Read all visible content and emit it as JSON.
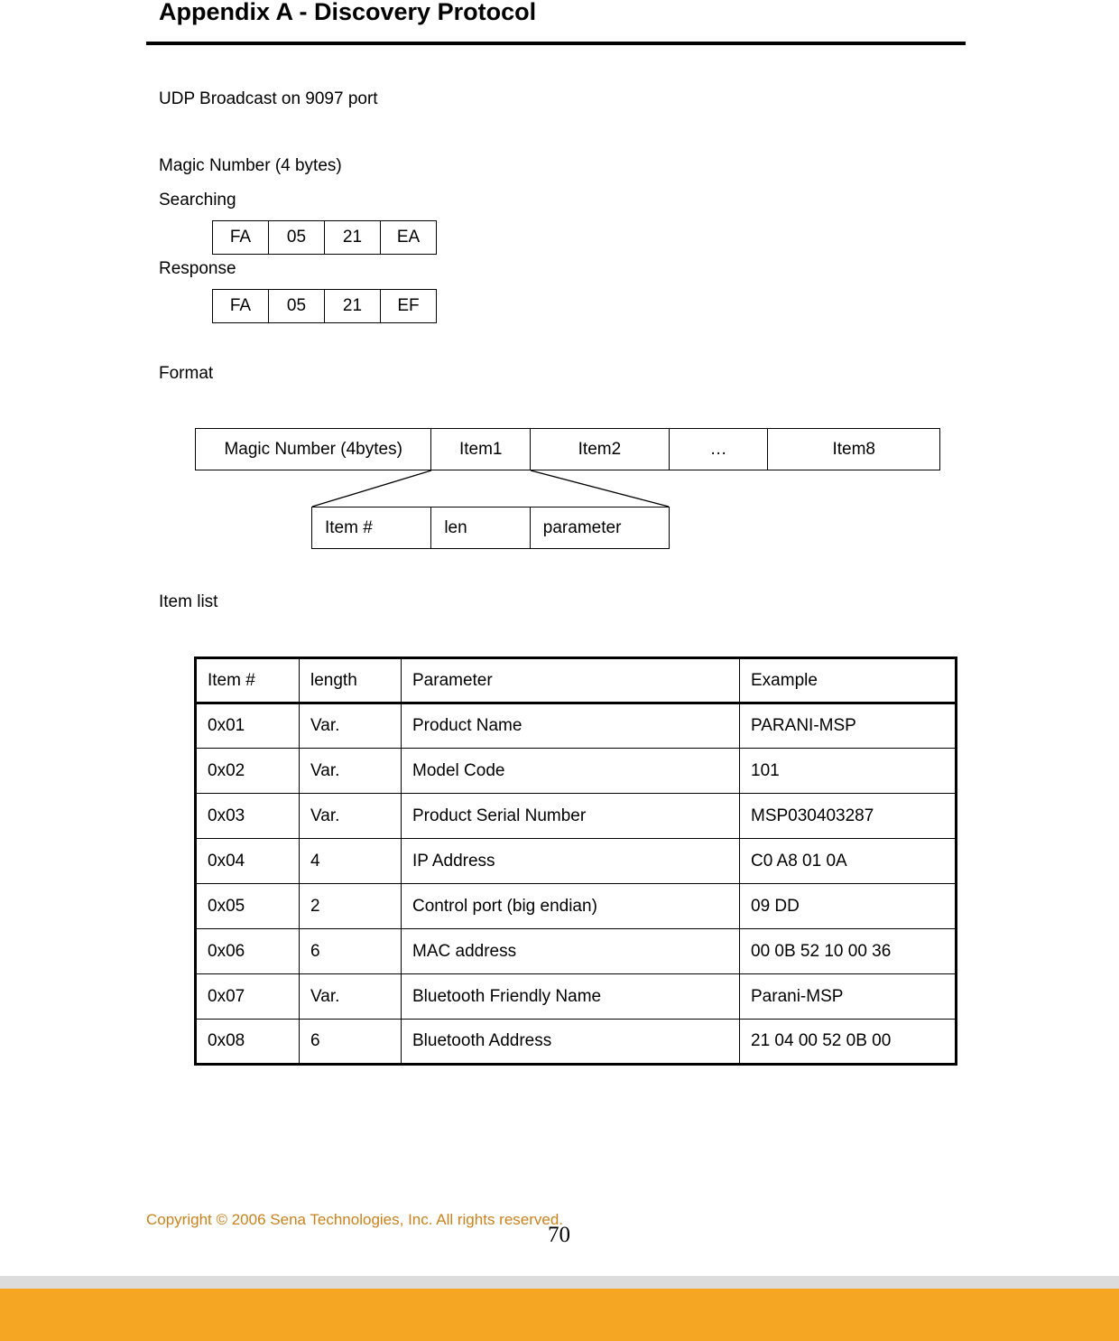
{
  "header": {
    "title": "Appendix A - Discovery Protocol"
  },
  "intro": {
    "udp_line": "UDP Broadcast on 9097 port"
  },
  "magic_number": {
    "heading": "Magic Number (4 bytes)",
    "searching_label": "Searching",
    "searching_bytes": [
      "FA",
      "05",
      "21",
      "EA"
    ],
    "response_label": "Response",
    "response_bytes": [
      "FA",
      "05",
      "21",
      "EF"
    ]
  },
  "format": {
    "heading": "Format",
    "packet_cells": [
      "Magic Number (4bytes)",
      "Item1",
      "Item2",
      "…",
      "Item8"
    ],
    "item_cells": [
      "Item #",
      "len",
      "parameter"
    ]
  },
  "item_list": {
    "heading": "Item list",
    "columns": [
      "Item #",
      "length",
      "Parameter",
      "Example"
    ],
    "rows": [
      [
        "0x01",
        "Var.",
        "Product Name",
        "PARANI-MSP"
      ],
      [
        "0x02",
        "Var.",
        "Model Code",
        "101"
      ],
      [
        "0x03",
        "Var.",
        "Product Serial Number",
        "MSP030403287"
      ],
      [
        "0x04",
        "4",
        "IP Address",
        "C0 A8 01 0A"
      ],
      [
        "0x05",
        "2",
        "Control port (big endian)",
        "09 DD"
      ],
      [
        "0x06",
        "6",
        "MAC address",
        "00 0B 52 10 00 36"
      ],
      [
        "0x07",
        "Var.",
        "Bluetooth Friendly Name",
        "Parani-MSP"
      ],
      [
        "0x08",
        "6",
        "Bluetooth Address",
        "21 04 00 52 0B 00"
      ]
    ]
  },
  "footer": {
    "copyright": "Copyright © 2006 Sena Technologies, Inc. All rights reserved.",
    "page_number": "70",
    "accent_color": "#F5A623",
    "copyright_color": "#C8821E",
    "divider_color": "#DCDCDC"
  }
}
